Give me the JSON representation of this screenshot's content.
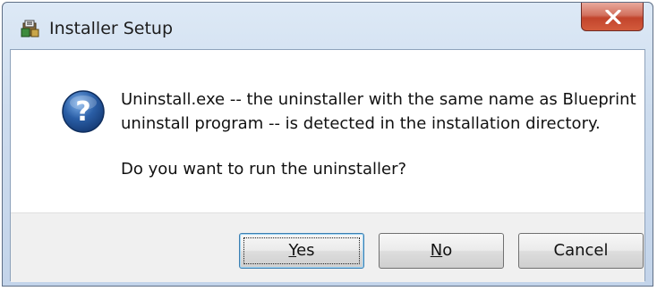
{
  "window": {
    "title": "Installer Setup",
    "icon": "installer-setup-icon",
    "close_icon": "close-icon"
  },
  "message": {
    "icon": "question-icon",
    "line1": "Uninstall.exe -- the uninstaller with the same name as Blueprint",
    "line2": "uninstall program -- is detected in the installation directory.",
    "line3": "Do you want to run the uninstaller?"
  },
  "buttons": {
    "yes_accel": "Y",
    "yes_rest": "es",
    "no_accel": "N",
    "no_rest": "o",
    "cancel": "Cancel"
  },
  "colors": {
    "titlebar": "#cddcee",
    "close_button": "#c2442c",
    "question_icon": "#2a5ea6",
    "button_face": "#e6e6e6"
  }
}
